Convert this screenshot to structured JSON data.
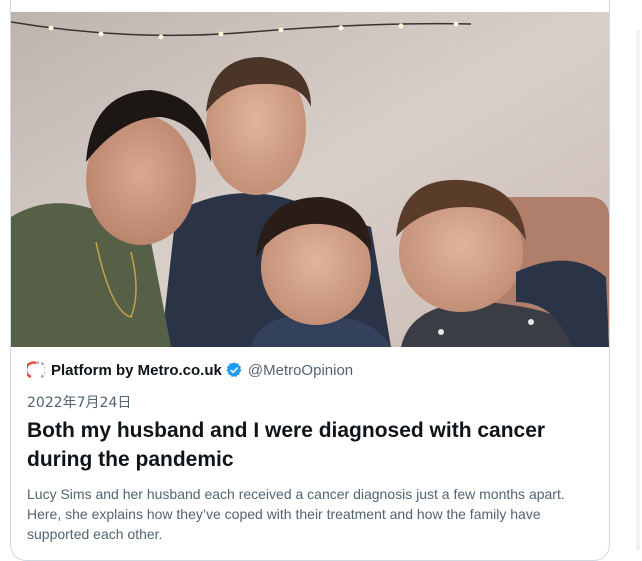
{
  "card": {
    "source_name": "Platform by Metro.co.uk",
    "handle": "@MetroOpinion",
    "date": "2022年7月24日",
    "headline": "Both my husband and I were diagnosed with cancer during the pandemic",
    "description": "Lucy Sims and her husband each received a cancer diagnosis just a few months apart. Here, she explains how they’ve coped with their treatment and how the family have supported each other.",
    "logo_icon": "metro-logo-icon",
    "verified_icon": "verified-badge-icon"
  },
  "colors": {
    "verified_blue": "#1d9bf0",
    "text_primary": "#0f1419",
    "text_secondary": "#536471"
  }
}
